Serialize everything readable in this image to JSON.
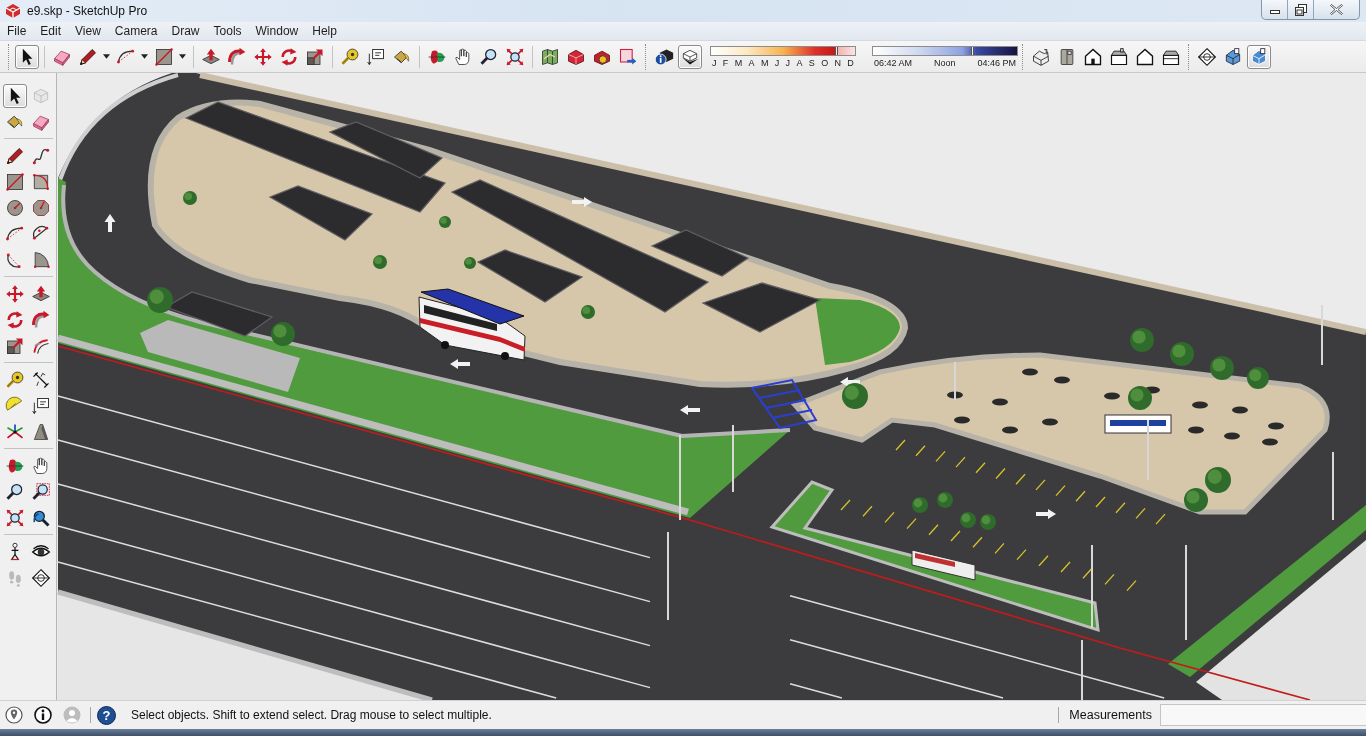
{
  "window": {
    "title": "e9.skp - SketchUp Pro"
  },
  "menu": [
    "File",
    "Edit",
    "View",
    "Camera",
    "Draw",
    "Tools",
    "Window",
    "Help"
  ],
  "toolbar": [
    {
      "kind": "tools",
      "new_toolbar": true,
      "tools": [
        {
          "selected": true,
          "dropdown": false
        }
      ]
    },
    {
      "kind": "tools",
      "new_toolbar": false,
      "tools": [
        {
          "selected": false,
          "dropdown": false
        },
        {
          "selected": false,
          "dropdown": true
        },
        {
          "selected": false,
          "dropdown": true
        },
        {
          "selected": false,
          "dropdown": true
        }
      ]
    },
    {
      "kind": "tools",
      "new_toolbar": false,
      "tools": [
        {
          "selected": false,
          "dropdown": false
        },
        {
          "selected": false,
          "dropdown": false
        },
        {
          "selected": false,
          "dropdown": false
        },
        {
          "selected": false,
          "dropdown": false
        },
        {
          "selected": false,
          "dropdown": false
        }
      ]
    },
    {
      "kind": "tools",
      "new_toolbar": false,
      "tools": [
        {
          "selected": false,
          "dropdown": false
        },
        {
          "selected": false,
          "dropdown": false
        },
        {
          "selected": false,
          "dropdown": false
        }
      ]
    },
    {
      "kind": "tools",
      "new_toolbar": false,
      "tools": [
        {
          "selected": false,
          "dropdown": false
        },
        {
          "selected": false,
          "dropdown": false
        },
        {
          "selected": false,
          "dropdown": false
        },
        {
          "selected": false,
          "dropdown": false
        }
      ]
    },
    {
      "kind": "tools",
      "new_toolbar": false,
      "tools": [
        {
          "selected": false,
          "dropdown": false
        },
        {
          "selected": false,
          "dropdown": false
        },
        {
          "selected": false,
          "dropdown": false
        },
        {
          "selected": false,
          "dropdown": false
        }
      ]
    },
    {
      "kind": "shadows",
      "new_toolbar": true,
      "tools": [
        {
          "selected": false,
          "dropdown": false
        },
        {
          "selected": true,
          "dropdown": false
        }
      ],
      "date_slider": {
        "months": [
          "J",
          "F",
          "M",
          "A",
          "M",
          "J",
          "J",
          "A",
          "S",
          "O",
          "N",
          "D"
        ],
        "level": 0.87
      },
      "time_slider": {
        "labels": [
          "06:42 AM",
          "Noon",
          "04:46 PM"
        ],
        "level": 0.69
      }
    },
    {
      "kind": "tools",
      "new_toolbar": true,
      "tools": [
        {
          "selected": false,
          "dropdown": false
        },
        {
          "selected": false,
          "dropdown": false
        },
        {
          "selected": false,
          "dropdown": false
        },
        {
          "selected": false,
          "dropdown": false
        },
        {
          "selected": false,
          "dropdown": false
        },
        {
          "selected": false,
          "dropdown": false
        }
      ]
    },
    {
      "kind": "tools",
      "new_toolbar": true,
      "tools": [
        {
          "selected": false,
          "dropdown": false
        },
        {
          "selected": false,
          "dropdown": false
        },
        {
          "selected": true,
          "dropdown": false
        }
      ]
    }
  ],
  "side_toolbar": [
    {
      "tools": [
        {
          "selected": true,
          "disabled": false
        },
        {
          "selected": false,
          "disabled": true
        },
        {
          "selected": false,
          "disabled": false
        },
        {
          "selected": false,
          "disabled": false
        }
      ]
    },
    {
      "tools": [
        {
          "selected": false,
          "disabled": false
        },
        {
          "selected": false,
          "disabled": false
        },
        {
          "selected": false,
          "disabled": false
        },
        {
          "selected": false,
          "disabled": false
        },
        {
          "selected": false,
          "disabled": false
        },
        {
          "selected": false,
          "disabled": false
        },
        {
          "selected": false,
          "disabled": false
        },
        {
          "selected": false,
          "disabled": false
        },
        {
          "selected": false,
          "disabled": false
        },
        {
          "selected": false,
          "disabled": false
        }
      ]
    },
    {
      "tools": [
        {
          "selected": false,
          "disabled": false
        },
        {
          "selected": false,
          "disabled": false
        },
        {
          "selected": false,
          "disabled": false
        },
        {
          "selected": false,
          "disabled": false
        },
        {
          "selected": false,
          "disabled": false
        },
        {
          "selected": false,
          "disabled": false
        }
      ]
    },
    {
      "tools": [
        {
          "selected": false,
          "disabled": false
        },
        {
          "selected": false,
          "disabled": false
        },
        {
          "selected": false,
          "disabled": false
        },
        {
          "selected": false,
          "disabled": false
        },
        {
          "selected": false,
          "disabled": false
        },
        {
          "selected": false,
          "disabled": false
        }
      ]
    },
    {
      "tools": [
        {
          "selected": false,
          "disabled": false
        },
        {
          "selected": false,
          "disabled": false
        },
        {
          "selected": false,
          "disabled": false
        },
        {
          "selected": false,
          "disabled": false
        },
        {
          "selected": false,
          "disabled": false
        },
        {
          "selected": false,
          "disabled": false
        }
      ]
    },
    {
      "tools": [
        {
          "selected": false,
          "disabled": false
        },
        {
          "selected": false,
          "disabled": false
        },
        {
          "selected": false,
          "disabled": true
        },
        {
          "selected": false,
          "disabled": false
        }
      ]
    }
  ],
  "status_bar": {
    "help": "?",
    "hint": "Select objects. Shift to extend select. Drag mouse to select multiple.",
    "measurements_label": "Measurements"
  }
}
